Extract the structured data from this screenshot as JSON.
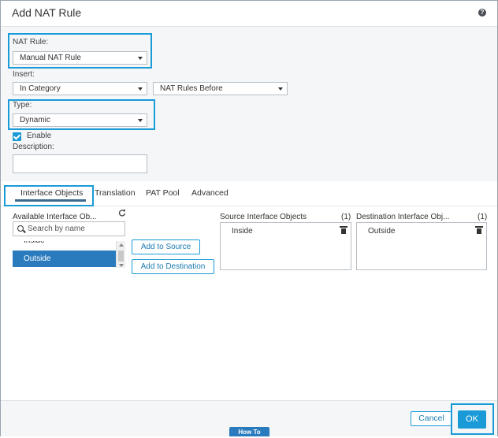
{
  "dialog": {
    "title": "Add NAT Rule",
    "help_icon": "question-circle-icon",
    "help_glyph": "?"
  },
  "form": {
    "nat_rule_label": "NAT Rule:",
    "nat_rule_value": "Manual NAT Rule",
    "insert_label": "Insert:",
    "insert_category_value": "In Category",
    "insert_position_value": "NAT Rules Before",
    "type_label": "Type:",
    "type_value": "Dynamic",
    "enable_label": "Enable",
    "enable_checked": true,
    "description_label": "Description:",
    "description_value": ""
  },
  "tabs": [
    {
      "label": "Interface Objects",
      "active": true
    },
    {
      "label": "Translation",
      "active": false
    },
    {
      "label": "PAT Pool",
      "active": false
    },
    {
      "label": "Advanced",
      "active": false
    }
  ],
  "interface_objects": {
    "available_header": "Available Interface Ob...",
    "refresh_icon": "refresh-icon",
    "search_placeholder": "Search by name",
    "available_items": [
      {
        "name": "Inside",
        "selected": false
      },
      {
        "name": "Outside",
        "selected": true
      }
    ],
    "add_to_source_label": "Add to Source",
    "add_to_destination_label": "Add to Destination",
    "source_header": "Source Interface Objects",
    "source_count": "(1)",
    "source_items": [
      "Inside"
    ],
    "destination_header": "Destination Interface Obj...",
    "destination_count": "(1)",
    "destination_items": [
      "Outside"
    ]
  },
  "footer": {
    "cancel_label": "Cancel",
    "ok_label": "OK",
    "how_to_label": "How To"
  },
  "colors": {
    "accent": "#1a9bd7",
    "selected_row": "#2a7bbd",
    "panel_bg": "#f5f6f7"
  }
}
